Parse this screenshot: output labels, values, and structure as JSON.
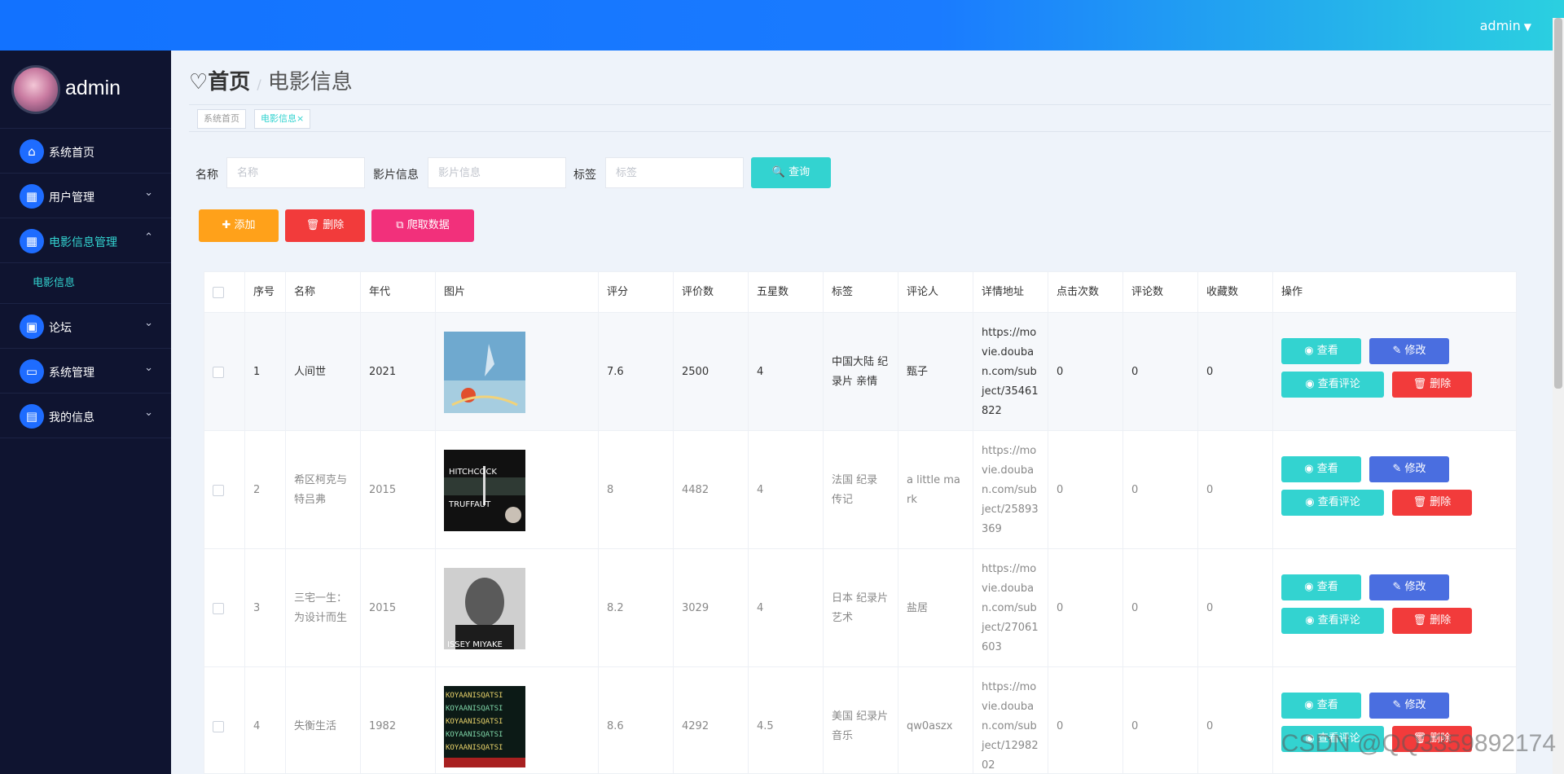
{
  "topbar": {
    "user": "admin",
    "caret": "▼"
  },
  "sidebar": {
    "profile_name": "admin",
    "items": [
      {
        "label": "系统首页",
        "icon": "⌂",
        "arrow": ""
      },
      {
        "label": "用户管理",
        "icon": "▦",
        "arrow": "⌄"
      },
      {
        "label": "电影信息管理",
        "icon": "▦",
        "arrow": "⌃"
      },
      {
        "label": "论坛",
        "icon": "▣",
        "arrow": "⌄"
      },
      {
        "label": "系统管理",
        "icon": "▭",
        "arrow": "⌄"
      },
      {
        "label": "我的信息",
        "icon": "▤",
        "arrow": "⌄"
      }
    ],
    "submenu": {
      "label": "电影信息"
    }
  },
  "header": {
    "home": "♡首页",
    "sep": "/",
    "current": "电影信息"
  },
  "tabs": [
    {
      "label": "系统首页"
    },
    {
      "label": "电影信息",
      "close": "×"
    }
  ],
  "search": {
    "name_label": "名称",
    "name_placeholder": "名称",
    "info_label": "影片信息",
    "info_placeholder": "影片信息",
    "tag_label": "标签",
    "tag_placeholder": "标签",
    "query": "🔍 查询"
  },
  "actions": {
    "add": "✚ 添加",
    "delete": "🗑 删除",
    "crawl": "⧉ 爬取数据"
  },
  "table": {
    "headers": [
      "",
      "序号",
      "名称",
      "年代",
      "图片",
      "评分",
      "评价数",
      "五星数",
      "标签",
      "评论人",
      "详情地址",
      "点击次数",
      "评论数",
      "收藏数",
      "操作"
    ],
    "rows": [
      {
        "no": "1",
        "name": "人间世",
        "year": "2021",
        "score": "7.6",
        "reviews": "2500",
        "five": "4",
        "tags": "中国大陆 纪录片 亲情",
        "reviewer": "甄子",
        "url": "https://movie.douban.com/subject/35461822",
        "clicks": "0",
        "comments": "0",
        "favs": "0"
      },
      {
        "no": "2",
        "name": "希区柯克与特吕弗",
        "year": "2015",
        "score": "8",
        "reviews": "4482",
        "five": "4",
        "tags": "法国 纪录 传记",
        "reviewer": "a little mark",
        "url": "https://movie.douban.com/subject/25893369",
        "clicks": "0",
        "comments": "0",
        "favs": "0"
      },
      {
        "no": "3",
        "name": "三宅一生：为设计而生",
        "year": "2015",
        "score": "8.2",
        "reviews": "3029",
        "five": "4",
        "tags": "日本 纪录片 艺术",
        "reviewer": "盐居",
        "url": "https://movie.douban.com/subject/27061603",
        "clicks": "0",
        "comments": "0",
        "favs": "0"
      },
      {
        "no": "4",
        "name": "失衡生活",
        "year": "1982",
        "score": "8.6",
        "reviews": "4292",
        "five": "4.5",
        "tags": "美国 纪录片 音乐",
        "reviewer": "qw0aszx",
        "url": "https://movie.douban.com/subject/1298202",
        "clicks": "0",
        "comments": "0",
        "favs": "0"
      }
    ],
    "ops": {
      "view": "◉ 查看",
      "edit": "✎ 修改",
      "comments": "◉ 查看评论",
      "delete": "🗑 删除"
    }
  },
  "posters": {
    "p2_title": "HITCHCOCK",
    "p2_sub": "TRUFFAUT",
    "p3_title": "ISSEY MIYAKE",
    "p4_text": "KOYAANISQATSI"
  },
  "watermark": "CSDN @QQ3359892174"
}
